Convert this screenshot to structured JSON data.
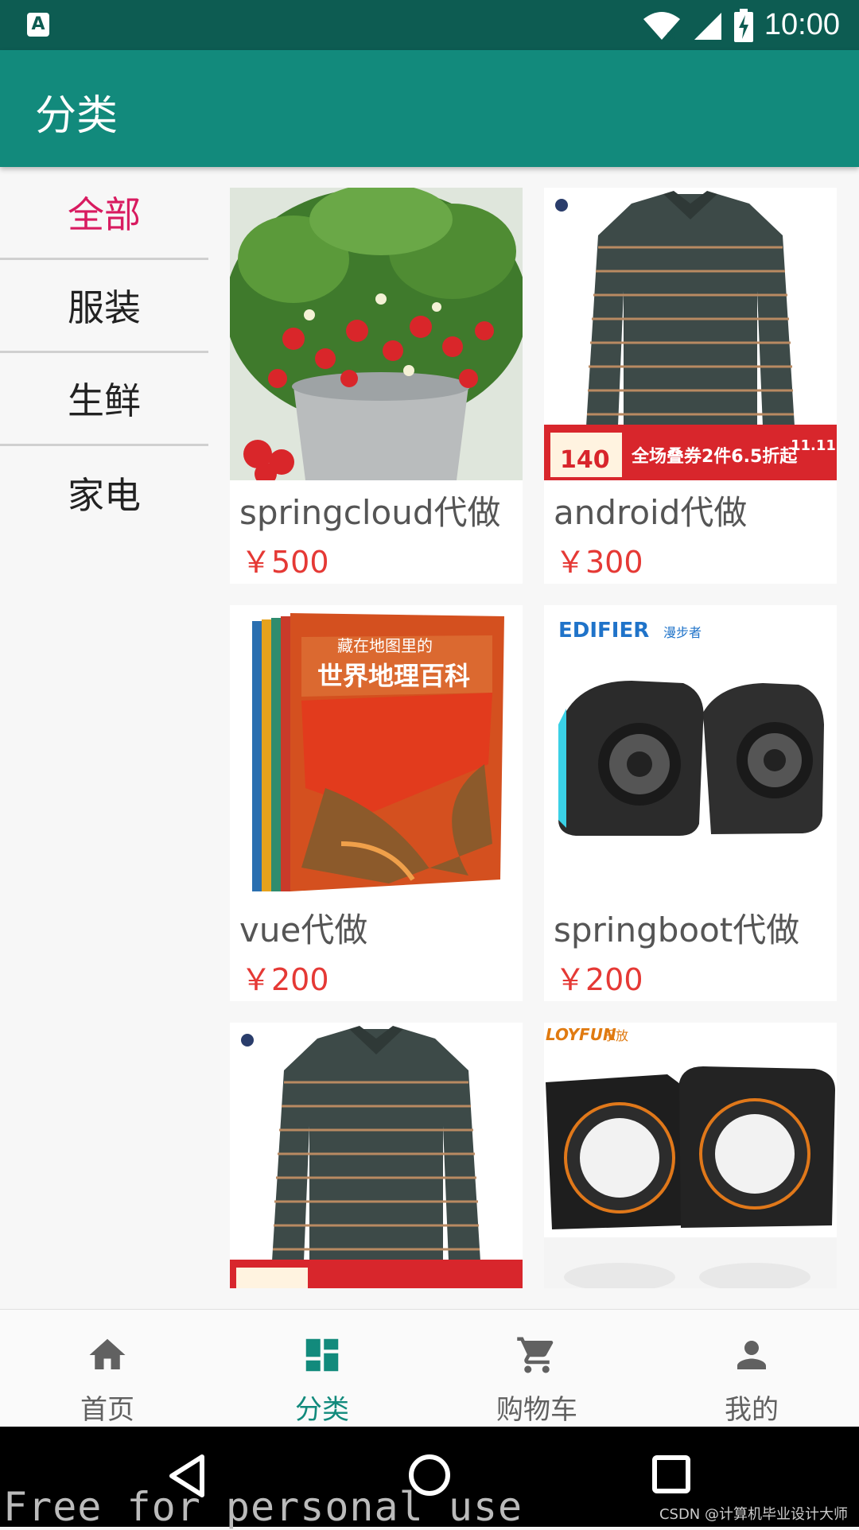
{
  "status_bar": {
    "time": "10:00",
    "notification_icon": "a-notification-icon"
  },
  "app_bar": {
    "title": "分类"
  },
  "categories": [
    {
      "label": "全部",
      "active": true
    },
    {
      "label": "服装",
      "active": false
    },
    {
      "label": "生鲜",
      "active": false
    },
    {
      "label": "家电",
      "active": false
    }
  ],
  "products": [
    {
      "name": "springcloud代做",
      "price": "￥500",
      "image": "strawberry-plant-image"
    },
    {
      "name": "android代做",
      "price": "￥300",
      "image": "striped-polo-shirt-image"
    },
    {
      "name": "vue代做",
      "price": "￥200",
      "image": "geography-encyclopedia-books-image"
    },
    {
      "name": "springboot代做",
      "price": "￥200",
      "image": "edifier-speakers-image"
    },
    {
      "name": "",
      "price": "",
      "image": "striped-polo-shirt-image"
    },
    {
      "name": "",
      "price": "",
      "image": "loyfun-speakers-image"
    }
  ],
  "image_text": {
    "book_title": "世界地理百科",
    "book_subtitle": "藏在地图里的",
    "edifier_brand": "EDIFIER",
    "edifier_cn": "漫步者",
    "loyfun_brand": "LOYFUN",
    "loyfun_cn": "乐放",
    "promo_price": "140",
    "promo_text": "全场叠券2件6.5折起",
    "promo_event": "11.11"
  },
  "bottom_nav": [
    {
      "label": "首页",
      "icon": "home-icon",
      "active": false
    },
    {
      "label": "分类",
      "icon": "grid-icon",
      "active": true
    },
    {
      "label": "购物车",
      "icon": "cart-icon",
      "active": false
    },
    {
      "label": "我的",
      "icon": "person-icon",
      "active": false
    }
  ],
  "watermark": "Free for personal use",
  "credit": "CSDN @计算机毕业设计大师",
  "colors": {
    "status_bar": "#0d5c52",
    "app_bar": "#128a7c",
    "active_category": "#d81b60",
    "price": "#e53935",
    "nav_active": "#128a7c"
  }
}
